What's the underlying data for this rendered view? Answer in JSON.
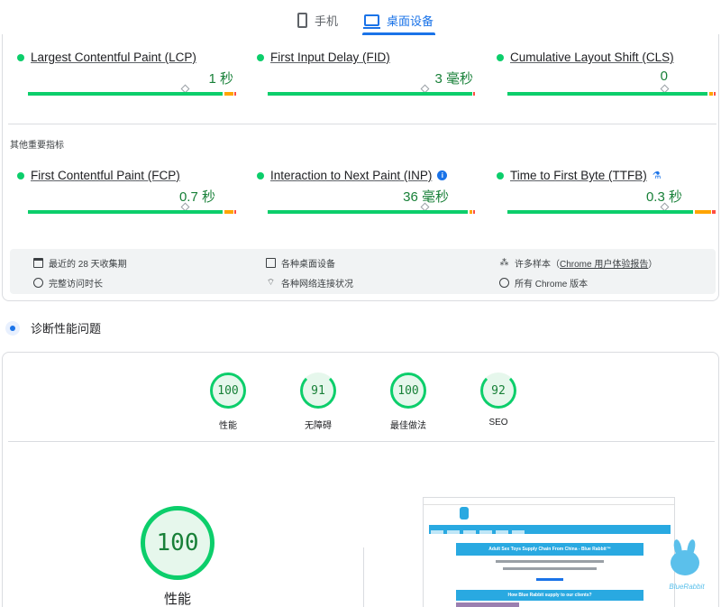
{
  "tabs": [
    {
      "label": "手机",
      "icon": "phone-icon",
      "active": false
    },
    {
      "label": "桌面设备",
      "icon": "desktop-icon",
      "active": true
    }
  ],
  "core_metrics": [
    {
      "name": "Largest Contentful Paint (LCP)",
      "value": "1 秒",
      "status": "good"
    },
    {
      "name": "First Input Delay (FID)",
      "value": "3 毫秒",
      "status": "good"
    },
    {
      "name": "Cumulative Layout Shift (CLS)",
      "value": "0",
      "status": "good"
    }
  ],
  "other_metrics_label": "其他重要指标",
  "other_metrics": [
    {
      "name": "First Contentful Paint (FCP)",
      "value": "0.7 秒",
      "status": "good"
    },
    {
      "name": "Interaction to Next Paint (INP)",
      "value": "36 毫秒",
      "status": "good",
      "badge": "info-icon"
    },
    {
      "name": "Time to First Byte (TTFB)",
      "value": "0.3 秒",
      "status": "good",
      "badge": "lab-flask-icon"
    }
  ],
  "info": {
    "period": "最近的 28 天收集期",
    "devices": "各种桌面设备",
    "samples_prefix": "许多样本（",
    "samples_link": "Chrome 用户体验报告",
    "samples_suffix": "）",
    "duration": "完整访问时长",
    "network": "各种网络连接状况",
    "versions": "所有 Chrome 版本"
  },
  "diagnose_title": "诊断性能问题",
  "scores": [
    {
      "label": "性能",
      "value": "100"
    },
    {
      "label": "无障碍",
      "value": "91"
    },
    {
      "label": "最佳做法",
      "value": "100"
    },
    {
      "label": "SEO",
      "value": "92"
    }
  ],
  "main_score": {
    "label": "性能",
    "value": "100"
  },
  "thumbnail": {
    "banner1": "Adult Sex Toys Supply Chain From China - Blue Rabbit™",
    "banner2": "How Blue Rabbit supply to our clients?"
  },
  "watermark": "BlueRabbit",
  "colors": {
    "good": "#0cce6b",
    "good_text": "#188038",
    "accent": "#1a73e8",
    "average": "#ffa400",
    "poor": "#ff4e42"
  }
}
